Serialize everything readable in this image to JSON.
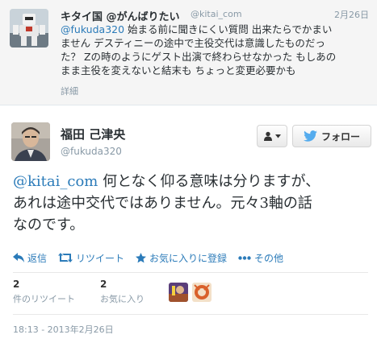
{
  "parent_tweet": {
    "display_name": "キタイ国 @がんばりたい",
    "handle": "@kitai_com",
    "date": "2月26日",
    "text_lines": [
      {
        "mention": "@fukuda320",
        "rest": " 始まる前に聞きにくい質問 出来たらでかまい"
      },
      {
        "text": "ません デスティニーの途中で主役交代は意識したものだっ"
      },
      {
        "text": "た？ Zの時のようにゲスト出演で終わらせなかった もしあの"
      },
      {
        "text": "まま主役を変えないと結末も ちょっと変更必要かも"
      }
    ],
    "details_label": "詳細"
  },
  "main_tweet": {
    "display_name": "福田 己津央",
    "handle": "@fukuda320",
    "follow_label": "フォロー",
    "text_lines": [
      {
        "mention": "@kitai_com",
        "rest": " 何となく仰る意味は分りますが、"
      },
      {
        "text": "あれは途中交代ではありません。元々3軸の話"
      },
      {
        "text": "なのです。"
      }
    ],
    "actions": {
      "reply": "返信",
      "retweet": "リツイート",
      "favorite": "お気に入りに登録",
      "more": "その他"
    },
    "stats": {
      "retweets_count": "2",
      "retweets_label": "件のリツイート",
      "favorites_count": "2",
      "favorites_label": "お気に入り"
    },
    "timestamp": "18:13 - 2013年2月26日"
  },
  "colors": {
    "link": "#2b7bb9",
    "twitter_blue": "#55acee",
    "muted": "#8899a6"
  }
}
